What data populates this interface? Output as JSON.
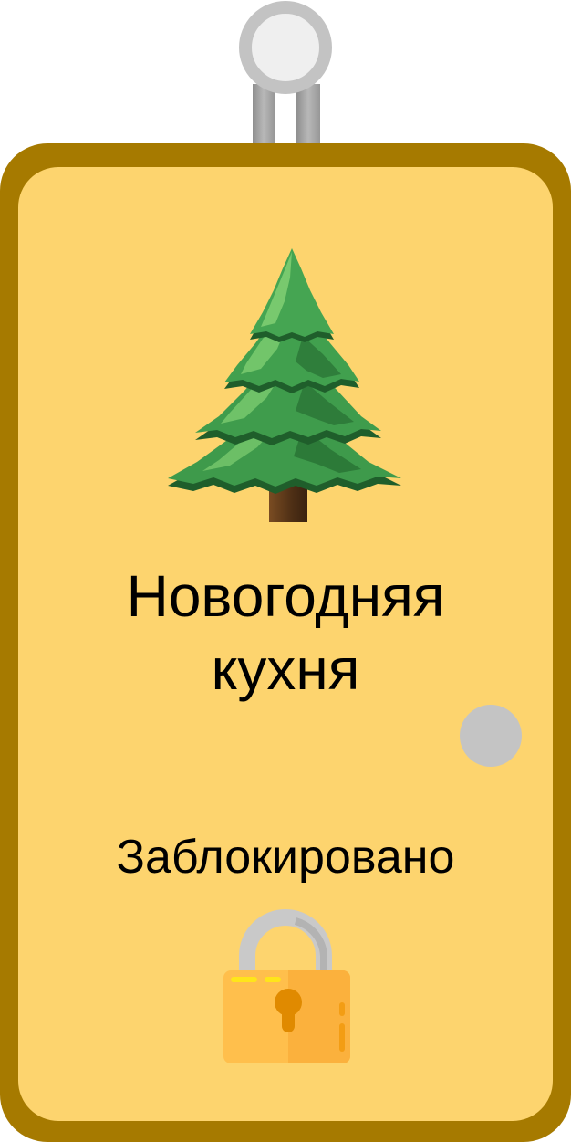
{
  "card": {
    "title": "Новогодняя кухня",
    "status": "Заблокировано"
  },
  "icons": {
    "hanger": "hanger-ring-icon",
    "emoji": "christmas-tree-icon",
    "knob": "door-knob-icon",
    "lock": "padlock-icon"
  },
  "colors": {
    "frame": "#a67a00",
    "panel": "#fdd46e",
    "knob": "#c4c4c4",
    "text": "#000000",
    "lock_body": "#ffbf4c",
    "keyhole": "#e08a00",
    "tree_green": "#3e9a4b"
  }
}
